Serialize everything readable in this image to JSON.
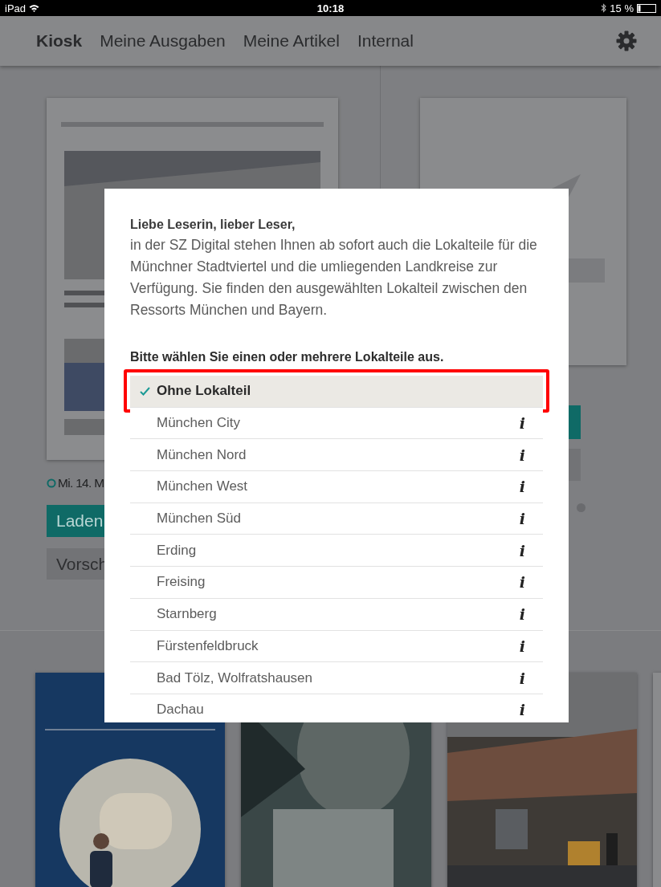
{
  "status_bar": {
    "device": "iPad",
    "time": "10:18",
    "battery": "15 %"
  },
  "nav": {
    "tabs": [
      {
        "label": "Kiosk",
        "selected": true
      },
      {
        "label": "Meine Ausgaben",
        "selected": false
      },
      {
        "label": "Meine Artikel",
        "selected": false
      },
      {
        "label": "Internal",
        "selected": false
      }
    ]
  },
  "kiosk": {
    "issue": {
      "date": "Mi. 14. M",
      "primary_button": "Laden",
      "secondary_button": "Vorsch"
    }
  },
  "dialog": {
    "greeting": "Liebe Leserin, lieber Leser,",
    "message": "in der SZ Digital stehen Ihnen ab sofort auch die Lokalteile für die Münchner Stadtviertel und die umliegenden Landkreise zur Verfügung. Sie finden den ausgewählten Lokalteil zwischen den Ressorts München und Bayern.",
    "prompt": "Bitte wählen Sie einen oder mehrere Lokalteile aus.",
    "options": [
      {
        "label": "Ohne Lokalteil",
        "selected": true,
        "highlighted": true
      },
      {
        "label": "München City",
        "selected": false,
        "highlighted": false,
        "info": "i"
      },
      {
        "label": "München Nord",
        "selected": false,
        "highlighted": false,
        "info": "i"
      },
      {
        "label": "München West",
        "selected": false,
        "highlighted": false,
        "info": "i"
      },
      {
        "label": "München Süd",
        "selected": false,
        "highlighted": false,
        "info": "i"
      },
      {
        "label": "Erding",
        "selected": false,
        "highlighted": false,
        "info": "i"
      },
      {
        "label": "Freising",
        "selected": false,
        "highlighted": false,
        "info": "i"
      },
      {
        "label": "Starnberg",
        "selected": false,
        "highlighted": false,
        "info": "i"
      },
      {
        "label": "Fürstenfeldbruck",
        "selected": false,
        "highlighted": false,
        "info": "i"
      },
      {
        "label": "Bad Tölz, Wolfratshausen",
        "selected": false,
        "highlighted": false,
        "info": "i"
      },
      {
        "label": "Dachau",
        "selected": false,
        "highlighted": false,
        "info": "i"
      }
    ]
  }
}
